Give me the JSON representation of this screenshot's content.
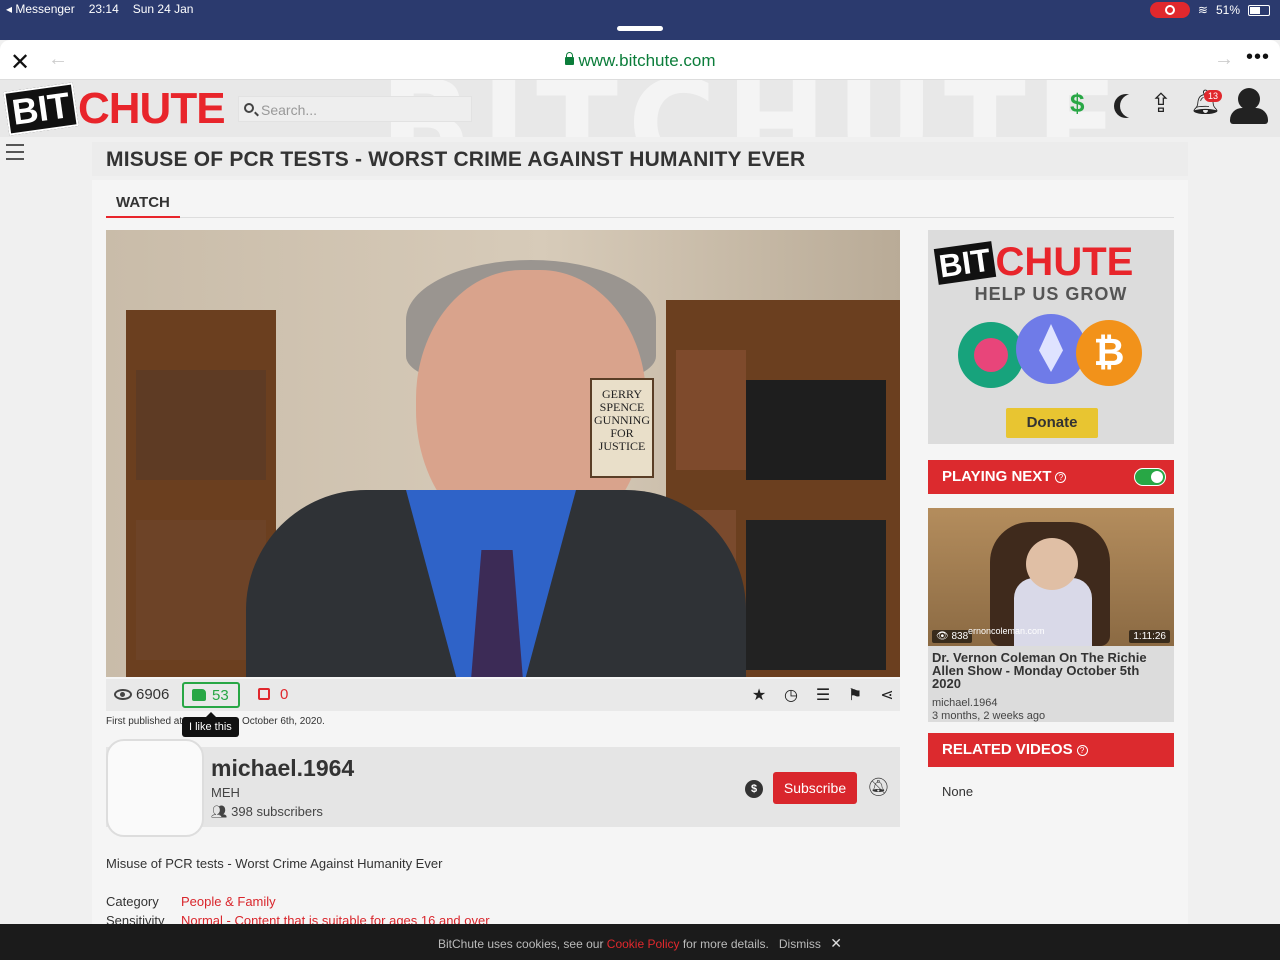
{
  "status_bar": {
    "back_app": "◂ Messenger",
    "time": "23:14",
    "date": "Sun 24 Jan",
    "battery": "51%"
  },
  "browser": {
    "url": "www.bitchute.com"
  },
  "header": {
    "logo_bit": "BIT",
    "logo_chute": "CHUTE",
    "search_placeholder": "Search...",
    "notifications_count": "13"
  },
  "video": {
    "title": "MISUSE OF PCR TESTS - WORST CRIME AGAINST HUMANITY EVER",
    "tab_watch": "WATCH",
    "book_cover_text": "GERRY SPENCE GUNNING FOR JUSTICE",
    "views": "6906",
    "likes": "53",
    "dislikes": "0",
    "published_prefix": "First published at",
    "published_date": "October 6th, 2020.",
    "like_tooltip": "I like this",
    "description": "Misuse of PCR tests - Worst Crime Against Humanity Ever"
  },
  "channel": {
    "name": "michael.1964",
    "subtitle": "MEH",
    "subscribers": "398 subscribers",
    "subscribe_label": "Subscribe",
    "tip_symbol": "$"
  },
  "meta": {
    "category_label": "Category",
    "category_value": "People & Family",
    "sensitivity_label": "Sensitivity",
    "sensitivity_value": "Normal - Content that is suitable for ages 16 and over"
  },
  "sidebar": {
    "donate": {
      "logo_bit": "BIT",
      "logo_chute": "CHUTE",
      "tagline": "HELP US GROW",
      "button": "Donate",
      "bitcoin_symbol": "₿"
    },
    "playing_next": {
      "label": "PLAYING NEXT",
      "views": "838",
      "site_overlay": "ernoncoleman.com",
      "duration": "1:11:26",
      "title": "Dr. Vernon Coleman On The Richie Allen Show - Monday October 5th 2020",
      "channel": "michael.1964",
      "age": "3 months, 2 weeks ago"
    },
    "related": {
      "label": "RELATED VIDEOS",
      "empty_text": "None"
    }
  },
  "cookie_bar": {
    "text_before": "BitChute uses cookies, see our",
    "link": "Cookie Policy",
    "text_after": "for more details.",
    "dismiss": "Dismiss"
  }
}
